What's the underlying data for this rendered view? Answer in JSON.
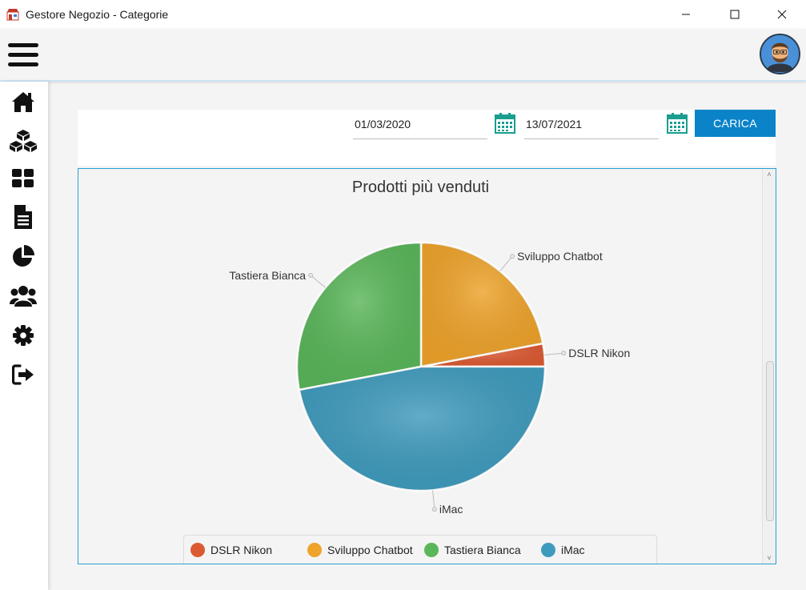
{
  "window": {
    "title": "Gestore Negozio - Categorie"
  },
  "filters": {
    "date_from": "01/03/2020",
    "date_to": "13/07/2021",
    "load_label": "CARICA"
  },
  "sidebar": {
    "items": [
      {
        "icon": "home-icon"
      },
      {
        "icon": "boxes-icon"
      },
      {
        "icon": "grid-icon"
      },
      {
        "icon": "document-icon"
      },
      {
        "icon": "pie-chart-icon"
      },
      {
        "icon": "users-icon"
      },
      {
        "icon": "gear-icon"
      },
      {
        "icon": "logout-icon"
      }
    ]
  },
  "chart_data": {
    "type": "pie",
    "title": "Prodotti più venduti",
    "labels": [
      "DSLR Nikon",
      "Sviluppo Chatbot",
      "Tastiera Bianca",
      "iMac"
    ],
    "values": [
      3,
      22,
      28,
      47
    ],
    "colors": [
      "#dc5a32",
      "#eea32a",
      "#5ab65a",
      "#3f9bbd"
    ],
    "legend": "bottom"
  }
}
